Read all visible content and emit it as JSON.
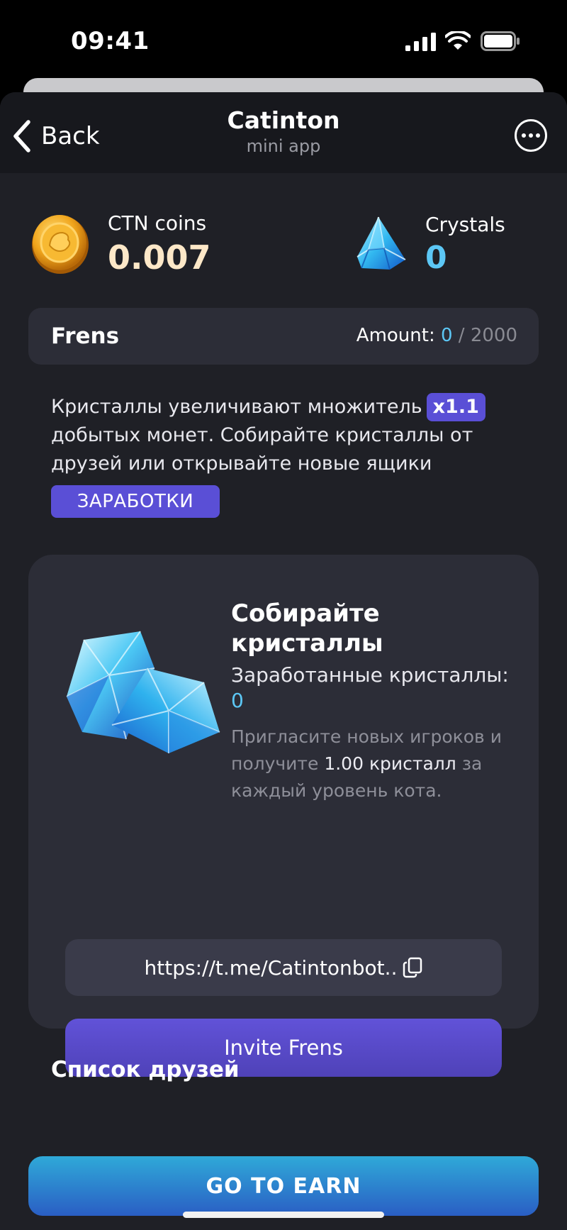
{
  "status_bar": {
    "time": "09:41",
    "icons": [
      "signal-icon",
      "wifi-icon",
      "battery-icon"
    ]
  },
  "header": {
    "back_label": "Back",
    "title": "Catinton",
    "subtitle": "mini app"
  },
  "balances": {
    "coins_label": "CTN coins",
    "coins_value": "0.007",
    "crystals_label": "Crystals",
    "crystals_value": "0"
  },
  "frens": {
    "title": "Frens",
    "amount_label": "Amount: ",
    "amount_current": "0",
    "amount_separator": " / ",
    "amount_max": "2000"
  },
  "info": {
    "text_before": "Кристаллы увеличивают множитель",
    "multiplier": "x1.1",
    "text_after": "добытых монет. Собирайте кристаллы от друзей или открывайте новые ящики",
    "earn_link": "ЗАРАБОТКИ"
  },
  "collect": {
    "title": "Собирайте кристаллы",
    "earned_label": "Заработанные кристаллы: ",
    "earned_value": "0",
    "desc_before": "Пригласите новых игроков и получите ",
    "desc_highlight": "1.00 кристалл",
    "desc_after": " за каждый уровень кота.",
    "referral_link": "https://t.me/Catintonbot..",
    "invite_button": "Invite Frens"
  },
  "friends": {
    "title": "Список друзей"
  },
  "footer": {
    "go_earn_label": "GO TO EARN"
  },
  "colors": {
    "background": "#1f2026",
    "card": "#2c2d37",
    "accent_purple": "#5a4fd6",
    "accent_cyan": "#5cc7f5",
    "coin_value": "#fde8c8"
  }
}
